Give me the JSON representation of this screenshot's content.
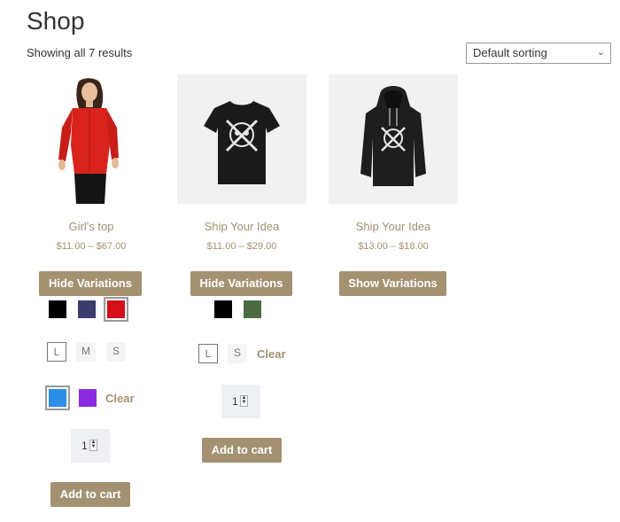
{
  "page": {
    "title": "Shop",
    "result_count": "Showing all 7 results"
  },
  "sorting": {
    "selected": "Default sorting"
  },
  "products": [
    {
      "name": "Girl's top",
      "price": "$11.00 – $67.00",
      "toggle_label": "Hide Variations",
      "colors": [
        "#000000",
        "#3b3b6d",
        "#d40f1a"
      ],
      "sizes": [
        "L",
        "M",
        "S"
      ],
      "extra_colors": [
        "#2b8fe6",
        "#8a2be2"
      ],
      "clear_label": "Clear",
      "quantity": "1",
      "add_to_cart": "Add to cart"
    },
    {
      "name": "Ship Your Idea",
      "price": "$11.00 – $29.00",
      "toggle_label": "Hide Variations",
      "colors": [
        "#000000",
        "#4d6b43"
      ],
      "sizes": [
        "L",
        "S"
      ],
      "clear_label": "Clear",
      "quantity": "1",
      "add_to_cart": "Add to cart"
    },
    {
      "name": "Ship Your Idea",
      "price": "$13.00 – $18.00",
      "toggle_label": "Show Variations"
    }
  ]
}
